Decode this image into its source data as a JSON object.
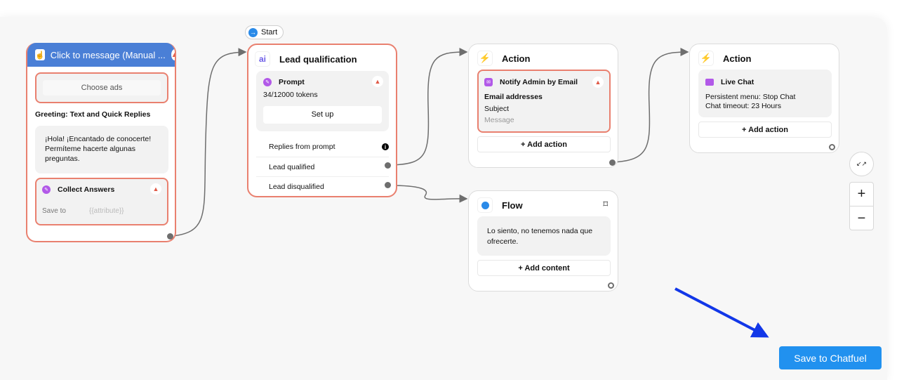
{
  "start_badge": {
    "label": "Start"
  },
  "node_trigger": {
    "title": "Click to message (Manual ...",
    "choose_ads": "Choose ads",
    "greeting_label": "Greeting: Text and Quick Replies",
    "greeting_text": "¡Hola! ¡Encantado de conocerte! Permíteme hacerte algunas preguntas.",
    "collect": {
      "title": "Collect Answers",
      "save_to_label": "Save to",
      "save_to_placeholder": "{{attribute}}"
    }
  },
  "node_lead": {
    "title": "Lead qualification",
    "prompt": {
      "title": "Prompt",
      "tokens": "34/12000 tokens",
      "setup_label": "Set up"
    },
    "replies": [
      {
        "label": "Replies from prompt"
      },
      {
        "label": "Lead qualified"
      },
      {
        "label": "Lead disqualified"
      }
    ]
  },
  "node_action1": {
    "title": "Action",
    "card": {
      "title": "Notify Admin by Email",
      "fields": [
        "Email addresses",
        "Subject"
      ],
      "placeholder": "Message"
    },
    "add_label": "+ Add action"
  },
  "node_action2": {
    "title": "Action",
    "card": {
      "title": "Live Chat",
      "lines": [
        "Persistent menu: Stop Chat",
        "Chat timeout: 23 Hours"
      ]
    },
    "add_label": "+ Add action"
  },
  "node_flow": {
    "title": "Flow",
    "text": "Lo siento, no tenemos nada que ofrecerte.",
    "add_label": "+ Add content"
  },
  "zoom_controls": {
    "fit": "↙↗",
    "zoom_in": "+",
    "zoom_out": "−"
  },
  "save_button": {
    "label": "Save to Chatfuel"
  },
  "colors": {
    "accent": "#2191ef",
    "header_blue": "#4a7fd6",
    "error": "#e9806f",
    "purple": "#b259e8",
    "arrow": "#1237e8"
  }
}
